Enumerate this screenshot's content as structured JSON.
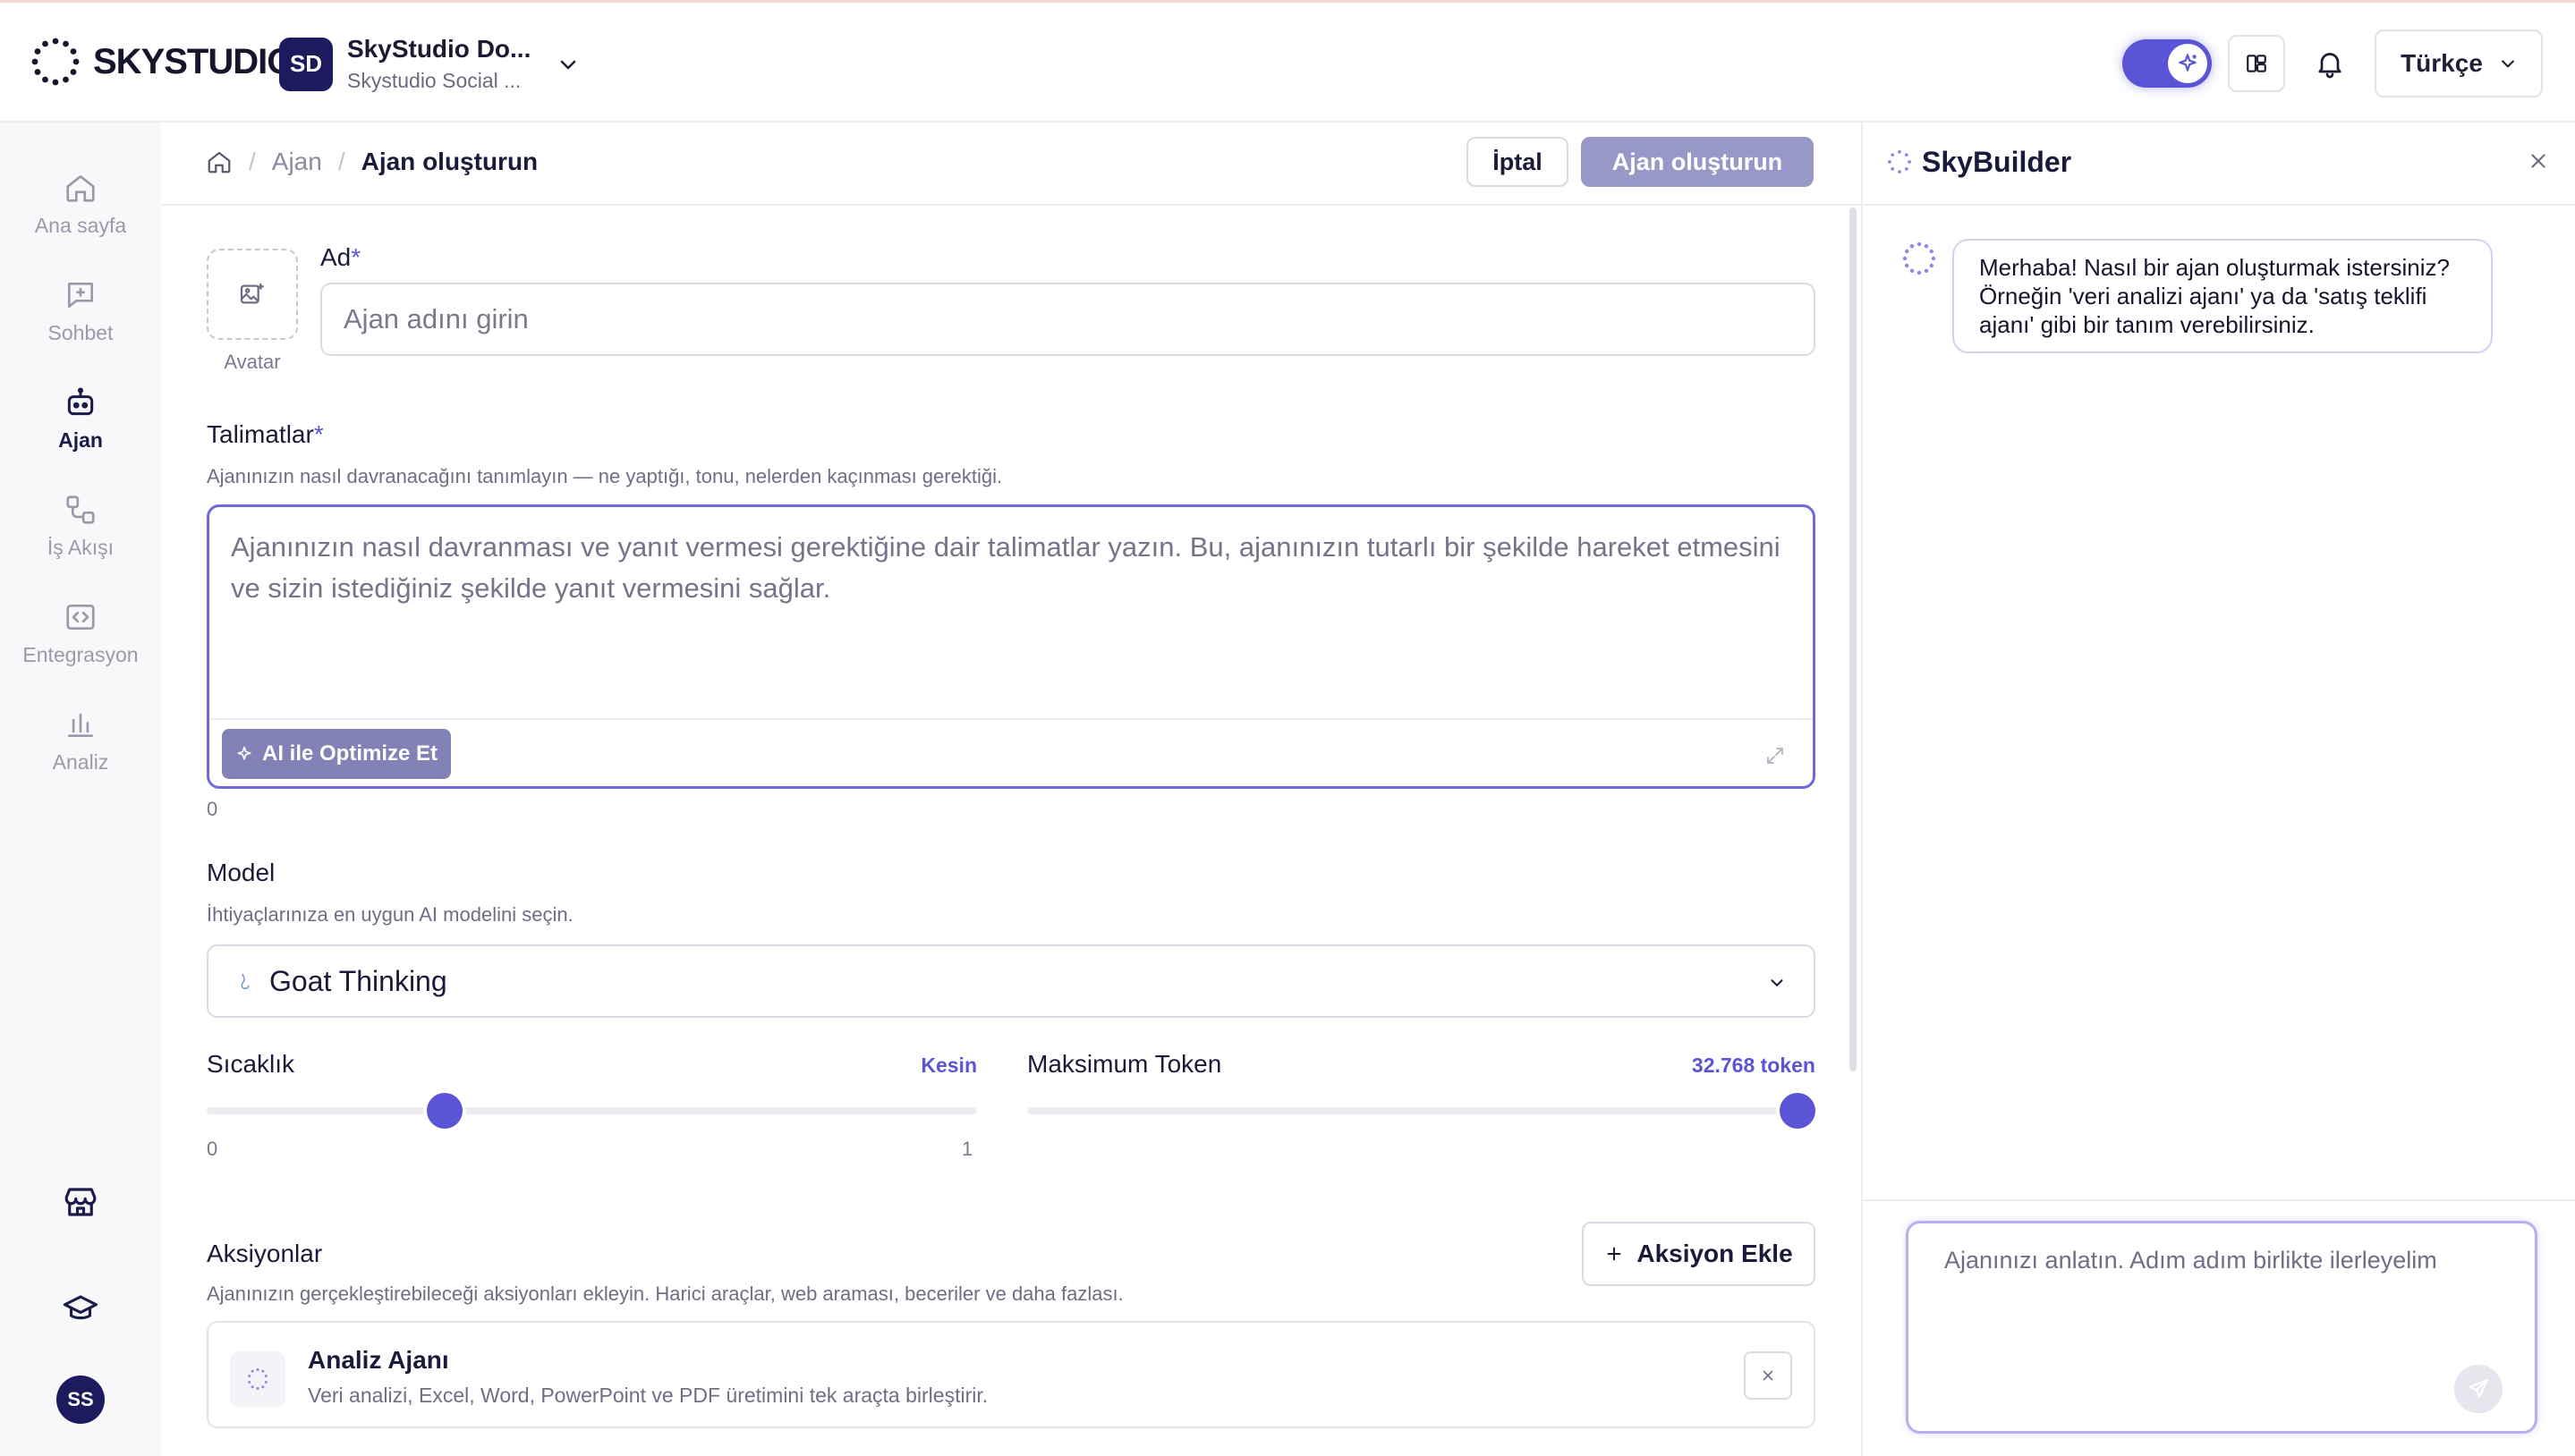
{
  "header": {
    "logo_text": "SKYSTUDIO",
    "workspace_badge": "SD",
    "workspace_name": "SkyStudio Do...",
    "workspace_sub": "Skystudio Social ...",
    "language": "Türkçe"
  },
  "sidebar": {
    "items": [
      {
        "label": "Ana sayfa",
        "icon": "home-icon"
      },
      {
        "label": "Sohbet",
        "icon": "chat-icon"
      },
      {
        "label": "Ajan",
        "icon": "robot-icon"
      },
      {
        "label": "İş Akışı",
        "icon": "workflow-icon"
      },
      {
        "label": "Entegrasyon",
        "icon": "code-icon"
      },
      {
        "label": "Analiz",
        "icon": "bar-chart-icon"
      }
    ],
    "user_initials": "SS"
  },
  "toolbar": {
    "breadcrumb": [
      "Ajan",
      "Ajan oluşturun"
    ],
    "cancel_label": "İptal",
    "create_label": "Ajan oluşturun"
  },
  "form": {
    "avatar_label": "Avatar",
    "name_label": "Ad",
    "required_mark": "*",
    "name_placeholder": "Ajan adını girin",
    "instructions_label": "Talimatlar",
    "instructions_help": "Ajanınızın nasıl davranacağını tanımlayın — ne yaptığı, tonu, nelerden kaçınması gerektiği.",
    "instructions_placeholder": "Ajanınızın nasıl davranması ve yanıt vermesi gerektiğine dair talimatlar yazın. Bu, ajanınızın tutarlı bir şekilde hareket etmesini ve sizin istediğiniz şekilde yanıt vermesini sağlar.",
    "optimize_label": "AI ile Optimize Et",
    "char_count": "0",
    "model_label": "Model",
    "model_help": "İhtiyaçlarınıza en uygun AI modelini seçin.",
    "model_value": "Goat Thinking",
    "temperature": {
      "label": "Sıcaklık",
      "value_label": "Kesin",
      "min": "0",
      "max": "1",
      "value": 0.3
    },
    "max_tokens": {
      "label": "Maksimum Token",
      "value_label": "32.768 token",
      "value": 1.0
    },
    "actions_label": "Aksiyonlar",
    "actions_help": "Ajanınızın gerçekleştirebileceği aksiyonları ekleyin. Harici araçlar, web araması, beceriler ve daha fazlası.",
    "add_action_label": "Aksiyon Ekle",
    "action_item": {
      "title": "Analiz Ajanı",
      "description": "Veri analizi, Excel, Word, PowerPoint ve PDF üretimini tek araçta birleştirir."
    }
  },
  "panel": {
    "title": "SkyBuilder",
    "message": "Merhaba! Nasıl bir ajan oluşturmak istersiniz? Örneğin 'veri analizi ajanı' ya da 'satış teklifi ajanı' gibi bir tanım verebilirsiniz.",
    "composer_placeholder": "Ajanınızı anlatın. Adım adım birlikte ilerleyelim"
  },
  "colors": {
    "accent": "#5b54d6",
    "create_button": "#9898c8",
    "optimize_button": "#8382b6",
    "brand_badge": "#1b1b5e"
  }
}
